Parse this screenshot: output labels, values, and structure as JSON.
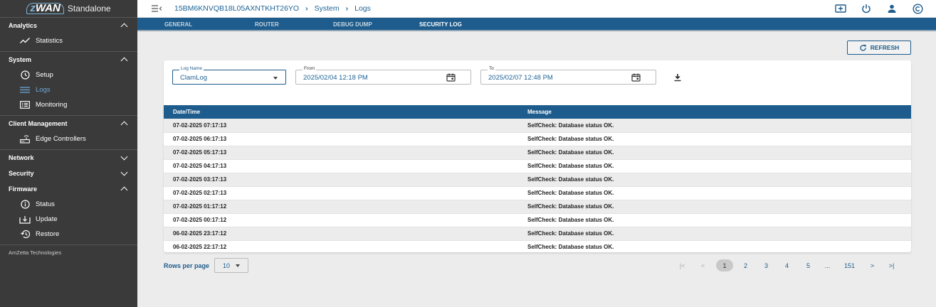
{
  "brand": {
    "logo_text": "zWAN",
    "edition": "Standalone"
  },
  "sidebar": {
    "sections": [
      {
        "label": "Analytics",
        "items": [
          {
            "label": "Statistics",
            "icon": "trend-icon"
          }
        ]
      },
      {
        "label": "System",
        "items": [
          {
            "label": "Setup",
            "icon": "clock-icon"
          },
          {
            "label": "Logs",
            "icon": "list-icon",
            "active": true
          },
          {
            "label": "Monitoring",
            "icon": "monitor-icon"
          }
        ]
      },
      {
        "label": "Client Management",
        "items": [
          {
            "label": "Edge Controllers",
            "icon": "router-icon"
          }
        ]
      },
      {
        "label": "Network",
        "items": []
      },
      {
        "label": "Security",
        "items": []
      },
      {
        "label": "Firmware",
        "items": [
          {
            "label": "Status",
            "icon": "info-icon"
          },
          {
            "label": "Update",
            "icon": "upload-icon"
          },
          {
            "label": "Restore",
            "icon": "restore-icon"
          }
        ]
      }
    ],
    "footer": "AmZetta Technologies"
  },
  "header": {
    "breadcrumb": [
      "15BM6KNVQB18L05AXNTKHT26YO",
      "System",
      "Logs"
    ],
    "icons": [
      "screen-icon",
      "power-icon",
      "user-icon",
      "copyright-icon"
    ]
  },
  "tabs": [
    {
      "label": "GENERAL",
      "active": false
    },
    {
      "label": "ROUTER",
      "active": false
    },
    {
      "label": "DEBUG DUMP",
      "active": false
    },
    {
      "label": "SECURITY LOG",
      "active": true
    }
  ],
  "toolbar": {
    "refresh_label": "REFRESH"
  },
  "filters": {
    "log_name_label": "Log Name",
    "log_name_value": "ClamLog",
    "from_label": "From",
    "from_value": "2025/02/04 12:18 PM",
    "to_label": "To",
    "to_value": "2025/02/07 12:48 PM"
  },
  "table": {
    "columns": [
      "Date/Time",
      "Message"
    ],
    "rows": [
      [
        "07-02-2025 07:17:13",
        "SelfCheck: Database status OK."
      ],
      [
        "07-02-2025 06:17:13",
        "SelfCheck: Database status OK."
      ],
      [
        "07-02-2025 05:17:13",
        "SelfCheck: Database status OK."
      ],
      [
        "07-02-2025 04:17:13",
        "SelfCheck: Database status OK."
      ],
      [
        "07-02-2025 03:17:13",
        "SelfCheck: Database status OK."
      ],
      [
        "07-02-2025 02:17:13",
        "SelfCheck: Database status OK."
      ],
      [
        "07-02-2025 01:17:12",
        "SelfCheck: Database status OK."
      ],
      [
        "07-02-2025 00:17:12",
        "SelfCheck: Database status OK."
      ],
      [
        "06-02-2025 23:17:12",
        "SelfCheck: Database status OK."
      ],
      [
        "06-02-2025 22:17:12",
        "SelfCheck: Database status OK."
      ]
    ]
  },
  "pagination": {
    "rows_per_page_label": "Rows per page",
    "rows_per_page_value": "10",
    "first": "|<",
    "prev": "<",
    "pages": [
      "1",
      "2",
      "3",
      "4",
      "5",
      "...",
      "151"
    ],
    "current_page": "1",
    "next": ">",
    "last": ">|"
  },
  "colors": {
    "accent": "#1d5c8c",
    "sidebar_bg": "#3a3a3a",
    "page_bg": "#ececec"
  }
}
